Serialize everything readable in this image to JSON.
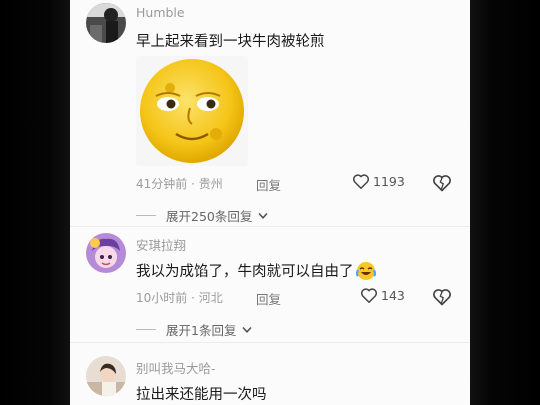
{
  "comments": [
    {
      "username": "Humble",
      "text": "早上起来看到一块牛肉被轮煎",
      "sticker": "moon-face-emoji",
      "time": "41分钟前",
      "location": "贵州",
      "reply_label": "回复",
      "likes": "1193",
      "expand_label": "展开250条回复"
    },
    {
      "username": "安琪拉翔",
      "text": "我以为成馅了，牛肉就可以自由了",
      "text_emoji": "crying-laughing-emoji",
      "time": "10小时前",
      "location": "河北",
      "reply_label": "回复",
      "likes": "143",
      "expand_label": "展开1条回复"
    },
    {
      "username": "别叫我马大哈-",
      "text": "拉出来还能用一次吗"
    }
  ],
  "separator": " · ",
  "colors": {
    "accent_yellow": "#f5c518",
    "meta_gray": "#9b9b9b",
    "background": "#fbfbfb"
  }
}
